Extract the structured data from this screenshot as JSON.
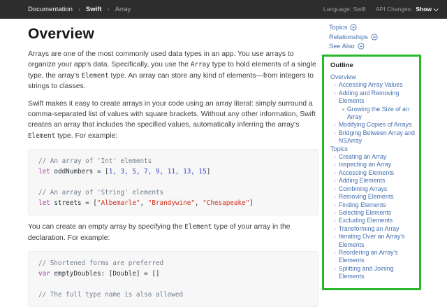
{
  "accents": {
    "highlight_green": "#29b829",
    "link_blue": "#4570b0",
    "header_bg": "#2d2d2d"
  },
  "header": {
    "breadcrumbs": [
      "Documentation",
      "Swift",
      "Array"
    ],
    "language_label": "Language:",
    "language_value": "Swift",
    "api_changes_label": "API Changes:",
    "api_changes_value": "Show"
  },
  "main": {
    "title": "Overview",
    "paragraphs": {
      "p1": [
        {
          "t": "Arrays are one of the most commonly used data types in an app. You use arrays to organize your app's data. Specifically, you use the "
        },
        {
          "t": "Array",
          "c": 1
        },
        {
          "t": " type to hold elements of a single type, the array's "
        },
        {
          "t": "Element",
          "c": 1
        },
        {
          "t": " type. An array can store any kind of elements—from integers to strings to classes."
        }
      ],
      "p2": [
        {
          "t": "Swift makes it easy to create arrays in your code using an array literal: simply surround a comma-separated list of values with square brackets. Without any other information, Swift creates an array that includes the specified values, automatically inferring the array's "
        },
        {
          "t": "Element",
          "c": 1
        },
        {
          "t": " type. For example:"
        }
      ],
      "p3": [
        {
          "t": "You can create an empty array by specifying the "
        },
        {
          "t": "Element",
          "c": 1
        },
        {
          "t": " type of your array in the declaration. For example:"
        }
      ]
    },
    "code_block_1": [
      [
        [
          "c",
          "// An array of 'Int' elements"
        ]
      ],
      [
        [
          "k",
          "let"
        ],
        [
          "p",
          " oddNumbers = ["
        ],
        [
          "n",
          "1, 3, 5, 7, 9, 11, 13, 15"
        ],
        [
          "p",
          "]"
        ]
      ],
      [],
      [
        [
          "c",
          "// An array of 'String' elements"
        ]
      ],
      [
        [
          "k",
          "let"
        ],
        [
          "p",
          " streets = ["
        ],
        [
          "s",
          "\"Albemarle\""
        ],
        [
          "p",
          ", "
        ],
        [
          "s",
          "\"Brandywine\""
        ],
        [
          "p",
          ", "
        ],
        [
          "s",
          "\"Chesapeake\""
        ],
        [
          "p",
          "]"
        ]
      ]
    ],
    "code_block_2": [
      [
        [
          "c",
          "// Shortened forms are preferred"
        ]
      ],
      [
        [
          "k",
          "var"
        ],
        [
          "p",
          " emptyDoubles: [Double] = []"
        ]
      ],
      [],
      [
        [
          "c",
          "// The full type name is also allowed"
        ]
      ]
    ]
  },
  "sidebar": {
    "toggles": [
      {
        "label": "Topics"
      },
      {
        "label": "Relationships"
      },
      {
        "label": "See Also"
      }
    ],
    "outline": {
      "title": "Outline",
      "items": [
        {
          "label": "Overview",
          "level": 0
        },
        {
          "label": "Accessing Array Values",
          "level": 1
        },
        {
          "label": "Adding and Removing Elements",
          "level": 1
        },
        {
          "label": "Growing the Size of an Array",
          "level": 2
        },
        {
          "label": "Modifying Copies of Arrays",
          "level": 1
        },
        {
          "label": "Bridging Between Array and NSArray",
          "level": 1
        },
        {
          "label": "Topics",
          "level": 0
        },
        {
          "label": "Creating an Array",
          "level": 1
        },
        {
          "label": "Inspecting an Array",
          "level": 1
        },
        {
          "label": "Accessing Elements",
          "level": 1
        },
        {
          "label": "Adding Elements",
          "level": 1
        },
        {
          "label": "Combining Arrays",
          "level": 1
        },
        {
          "label": "Removing Elements",
          "level": 1
        },
        {
          "label": "Finding Elements",
          "level": 1
        },
        {
          "label": "Selecting Elements",
          "level": 1
        },
        {
          "label": "Excluding Elements",
          "level": 1
        },
        {
          "label": "Transforming an Array",
          "level": 1
        },
        {
          "label": "Iterating Over an Array's Elements",
          "level": 1
        },
        {
          "label": "Reordering an Array's Elements",
          "level": 1
        },
        {
          "label": "Splitting and Joining Elements",
          "level": 1
        }
      ]
    }
  }
}
